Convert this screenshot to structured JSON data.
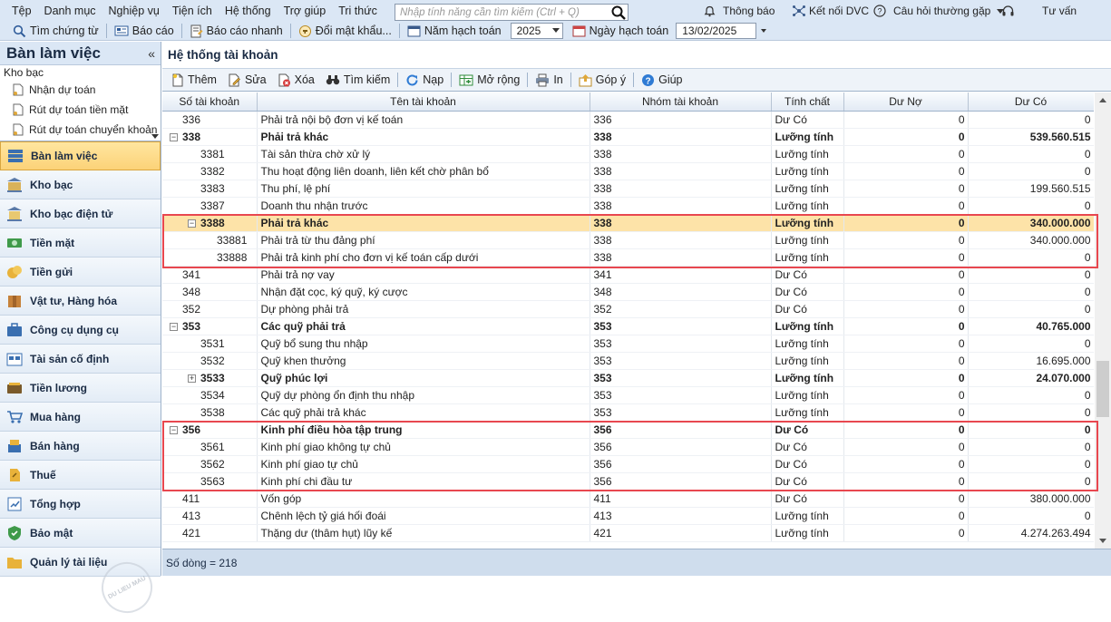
{
  "menu": [
    "Tệp",
    "Danh mục",
    "Nghiệp vụ",
    "Tiện ích",
    "Hệ thống",
    "Trợ giúp",
    "Tri thức"
  ],
  "search": {
    "placeholder": "Nhập tính năng cần tìm kiếm (Ctrl + Q)"
  },
  "right_menu": {
    "notifications": "Thông báo",
    "connect": "Kết nối DVC",
    "faq": "Câu hỏi thường gặp",
    "advice": "Tư vấn"
  },
  "toolbar": {
    "voucher_search": "Tìm chứng từ",
    "report": "Báo cáo",
    "quick_report": "Báo cáo nhanh",
    "change_password": "Đổi mật khẩu...",
    "fiscal_year_label": "Năm hạch toán",
    "fiscal_year": "2025",
    "posting_date_label": "Ngày hạch toán",
    "posting_date": "13/02/2025"
  },
  "sidebar": {
    "title": "Bàn làm việc",
    "tree_root": "Kho bạc",
    "tree_items": [
      "Nhận dự toán",
      "Rút dự toán tiền mặt",
      "Rút dự toán chuyển khoản"
    ],
    "items": [
      {
        "label": "Bàn làm việc",
        "icon": "desk-icon"
      },
      {
        "label": "Kho bạc",
        "icon": "treasury-icon"
      },
      {
        "label": "Kho bạc điện tử",
        "icon": "e-treasury-icon"
      },
      {
        "label": "Tiền mặt",
        "icon": "cash-icon"
      },
      {
        "label": "Tiền gửi",
        "icon": "deposit-icon"
      },
      {
        "label": "Vật tư, Hàng hóa",
        "icon": "goods-icon"
      },
      {
        "label": "Công cụ dụng cụ",
        "icon": "tools-icon"
      },
      {
        "label": "Tài sản cố định",
        "icon": "fixed-asset-icon"
      },
      {
        "label": "Tiền lương",
        "icon": "salary-icon"
      },
      {
        "label": "Mua hàng",
        "icon": "cart-icon"
      },
      {
        "label": "Bán hàng",
        "icon": "sales-icon"
      },
      {
        "label": "Thuế",
        "icon": "tax-icon"
      },
      {
        "label": "Tổng hợp",
        "icon": "summary-icon"
      },
      {
        "label": "Bảo mật",
        "icon": "shield-icon"
      },
      {
        "label": "Quản lý tài liệu",
        "icon": "folder-icon"
      }
    ]
  },
  "main": {
    "title": "Hệ thống tài khoản",
    "tools": {
      "add": "Thêm",
      "edit": "Sửa",
      "delete": "Xóa",
      "search": "Tìm kiếm",
      "reload": "Nạp",
      "expand": "Mở rộng",
      "print": "In",
      "feedback": "Góp ý",
      "help": "Giúp"
    },
    "columns": [
      "Số tài khoản",
      "Tên tài khoản",
      "Nhóm tài khoản",
      "Tính chất",
      "Dư Nợ",
      "Dư Có"
    ],
    "rows": [
      {
        "code": "336",
        "name": "Phải trả nội bộ đơn vị kế toán",
        "group": "336",
        "nature": "Dư Có",
        "debit": "0",
        "credit": "0",
        "level": 0,
        "bold": false,
        "toggle": ""
      },
      {
        "code": "338",
        "name": "Phải trả khác",
        "group": "338",
        "nature": "Lưỡng tính",
        "debit": "0",
        "credit": "539.560.515",
        "level": 0,
        "bold": true,
        "toggle": "−"
      },
      {
        "code": "3381",
        "name": "Tài sản thừa chờ xử lý",
        "group": "338",
        "nature": "Lưỡng tính",
        "debit": "0",
        "credit": "0",
        "level": 1,
        "bold": false,
        "toggle": ""
      },
      {
        "code": "3382",
        "name": "Thu hoạt động liên doanh, liên kết chờ phân bổ",
        "group": "338",
        "nature": "Lưỡng tính",
        "debit": "0",
        "credit": "0",
        "level": 1,
        "bold": false,
        "toggle": ""
      },
      {
        "code": "3383",
        "name": "Thu phí, lệ phí",
        "group": "338",
        "nature": "Lưỡng tính",
        "debit": "0",
        "credit": "199.560.515",
        "level": 1,
        "bold": false,
        "toggle": ""
      },
      {
        "code": "3387",
        "name": "Doanh thu nhận trước",
        "group": "338",
        "nature": "Lưỡng tính",
        "debit": "0",
        "credit": "0",
        "level": 1,
        "bold": false,
        "toggle": ""
      },
      {
        "code": "3388",
        "name": "Phải trả khác",
        "group": "338",
        "nature": "Lưỡng tính",
        "debit": "0",
        "credit": "340.000.000",
        "level": 1,
        "bold": true,
        "toggle": "−",
        "highlight": true
      },
      {
        "code": "33881",
        "name": "Phải trả từ thu đảng phí",
        "group": "338",
        "nature": "Lưỡng tính",
        "debit": "0",
        "credit": "340.000.000",
        "level": 2,
        "bold": false,
        "toggle": ""
      },
      {
        "code": "33888",
        "name": "Phải trả kinh phí cho đơn vị kế toán cấp dưới",
        "group": "338",
        "nature": "Lưỡng tính",
        "debit": "0",
        "credit": "0",
        "level": 2,
        "bold": false,
        "toggle": ""
      },
      {
        "code": "341",
        "name": "Phải trả nợ vay",
        "group": "341",
        "nature": "Dư Có",
        "debit": "0",
        "credit": "0",
        "level": 0,
        "bold": false,
        "toggle": ""
      },
      {
        "code": "348",
        "name": "Nhận đặt cọc, ký quỹ, ký cược",
        "group": "348",
        "nature": "Dư Có",
        "debit": "0",
        "credit": "0",
        "level": 0,
        "bold": false,
        "toggle": ""
      },
      {
        "code": "352",
        "name": "Dự phòng phải trả",
        "group": "352",
        "nature": "Dư Có",
        "debit": "0",
        "credit": "0",
        "level": 0,
        "bold": false,
        "toggle": ""
      },
      {
        "code": "353",
        "name": "Các quỹ phải trả",
        "group": "353",
        "nature": "Lưỡng tính",
        "debit": "0",
        "credit": "40.765.000",
        "level": 0,
        "bold": true,
        "toggle": "−"
      },
      {
        "code": "3531",
        "name": "Quỹ bổ sung thu nhập",
        "group": "353",
        "nature": "Lưỡng tính",
        "debit": "0",
        "credit": "0",
        "level": 1,
        "bold": false,
        "toggle": ""
      },
      {
        "code": "3532",
        "name": "Quỹ khen thưởng",
        "group": "353",
        "nature": "Lưỡng tính",
        "debit": "0",
        "credit": "16.695.000",
        "level": 1,
        "bold": false,
        "toggle": ""
      },
      {
        "code": "3533",
        "name": "Quỹ phúc lợi",
        "group": "353",
        "nature": "Lưỡng tính",
        "debit": "0",
        "credit": "24.070.000",
        "level": 1,
        "bold": true,
        "toggle": "+"
      },
      {
        "code": "3534",
        "name": "Quỹ dự phòng ổn định thu nhập",
        "group": "353",
        "nature": "Lưỡng tính",
        "debit": "0",
        "credit": "0",
        "level": 1,
        "bold": false,
        "toggle": ""
      },
      {
        "code": "3538",
        "name": "Các quỹ phải trả khác",
        "group": "353",
        "nature": "Lưỡng tính",
        "debit": "0",
        "credit": "0",
        "level": 1,
        "bold": false,
        "toggle": ""
      },
      {
        "code": "356",
        "name": "Kinh phí điều hòa tập trung",
        "group": "356",
        "nature": "Dư Có",
        "debit": "0",
        "credit": "0",
        "level": 0,
        "bold": true,
        "toggle": "−"
      },
      {
        "code": "3561",
        "name": "Kinh phí giao không tự chủ",
        "group": "356",
        "nature": "Dư Có",
        "debit": "0",
        "credit": "0",
        "level": 1,
        "bold": false,
        "toggle": ""
      },
      {
        "code": "3562",
        "name": "Kinh phí giao tự chủ",
        "group": "356",
        "nature": "Dư Có",
        "debit": "0",
        "credit": "0",
        "level": 1,
        "bold": false,
        "toggle": ""
      },
      {
        "code": "3563",
        "name": "Kinh phí chi đầu tư",
        "group": "356",
        "nature": "Dư Có",
        "debit": "0",
        "credit": "0",
        "level": 1,
        "bold": false,
        "toggle": ""
      },
      {
        "code": "411",
        "name": "Vốn góp",
        "group": "411",
        "nature": "Dư Có",
        "debit": "0",
        "credit": "380.000.000",
        "level": 0,
        "bold": false,
        "toggle": ""
      },
      {
        "code": "413",
        "name": "Chênh lệch tỷ giá hối đoái",
        "group": "413",
        "nature": "Lưỡng tính",
        "debit": "0",
        "credit": "0",
        "level": 0,
        "bold": false,
        "toggle": ""
      },
      {
        "code": "421",
        "name": "Thặng dư (thâm hụt) lũy kế",
        "group": "421",
        "nature": "Lưỡng tính",
        "debit": "0",
        "credit": "4.274.263.494",
        "level": 0,
        "bold": false,
        "toggle": ""
      }
    ],
    "row_count": "Số dòng = 218"
  },
  "colors": {
    "accent": "#1a2b44",
    "highlight": "#fde3a8",
    "annotation": "#e8474f"
  }
}
